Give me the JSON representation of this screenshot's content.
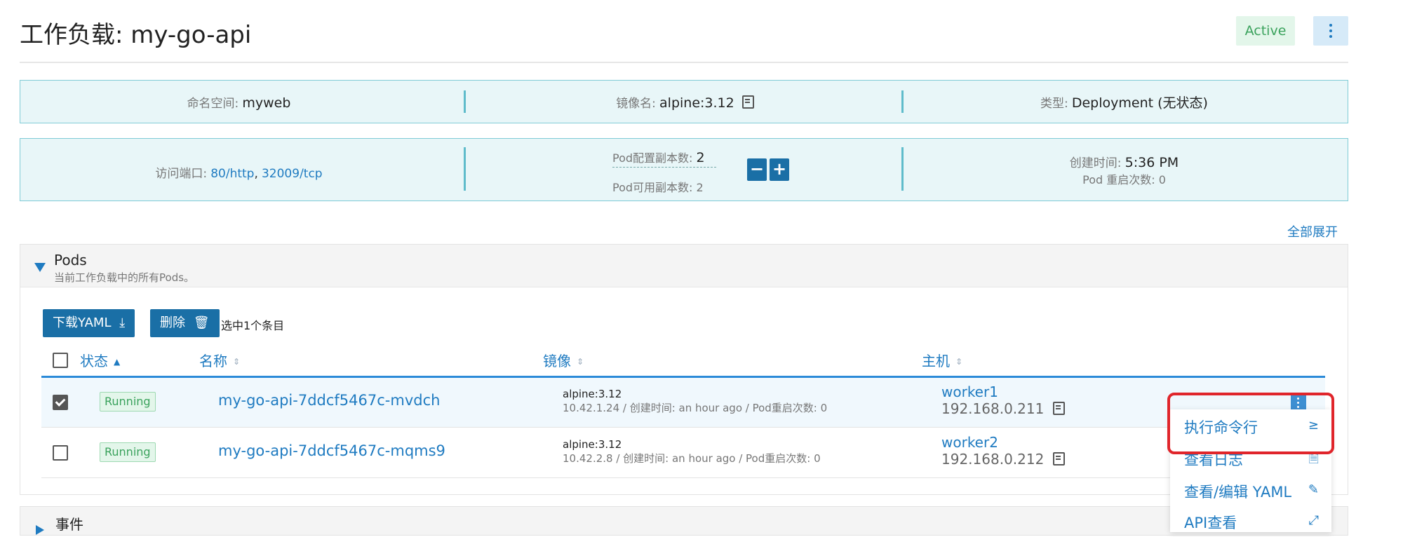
{
  "header": {
    "title": "工作负载: my-go-api",
    "status": "Active"
  },
  "info_row1": {
    "namespace_label": "命名空间:",
    "namespace_value": "myweb",
    "image_label": "镜像名:",
    "image_value": "alpine:3.12",
    "type_label": "类型:",
    "type_value": "Deployment (无状态)"
  },
  "info_row2": {
    "ports_label": "访问端口:",
    "ports": [
      "80/http",
      "32009/tcp"
    ],
    "ports_separator": ",",
    "replicas_config_label": "Pod配置副本数:",
    "replicas_config_value": "2",
    "replicas_available_text": "Pod可用副本数: 2",
    "minus": "−",
    "plus": "+",
    "created_label": "创建时间:",
    "created_value": "5:36 PM",
    "restarts_text": "Pod 重启次数: 0"
  },
  "expand_all": "全部展开",
  "pods": {
    "title": "Pods",
    "subtitle": "当前工作负载中的所有Pods。",
    "download_yaml": "下载YAML",
    "delete": "删除",
    "selected_text": "选中1个条目",
    "columns": [
      "状态",
      "名称",
      "镜像",
      "主机"
    ],
    "rows": [
      {
        "checked": true,
        "status": "Running",
        "name": "my-go-api-7ddcf5467c-mvdch",
        "image": "alpine:3.12",
        "image_detail": "10.42.1.24 / 创建时间: an hour ago / Pod重启次数: 0",
        "host": "worker1",
        "host_ip": "192.168.0.211"
      },
      {
        "checked": false,
        "status": "Running",
        "name": "my-go-api-7ddcf5467c-mqms9",
        "image": "alpine:3.12",
        "image_detail": "10.42.2.8 / 创建时间: an hour ago / Pod重启次数: 0",
        "host": "worker2",
        "host_ip": "192.168.0.212"
      }
    ]
  },
  "events": {
    "title": "事件"
  },
  "row_menu": [
    {
      "label": "执行命令行",
      "icon": "≥",
      "icon_name": "terminal-icon"
    },
    {
      "label": "查看日志",
      "icon": "🗎",
      "icon_name": "document-icon"
    },
    {
      "label": "查看/编辑 YAML",
      "icon": "✎",
      "icon_name": "pencil-icon"
    },
    {
      "label": "API查看",
      "icon": "⤢",
      "icon_name": "api-icon"
    }
  ],
  "colors": {
    "accent": "#1f7bc1",
    "button": "#1a6fa6",
    "highlight": "#e0252b",
    "success": "#3aa25c"
  }
}
